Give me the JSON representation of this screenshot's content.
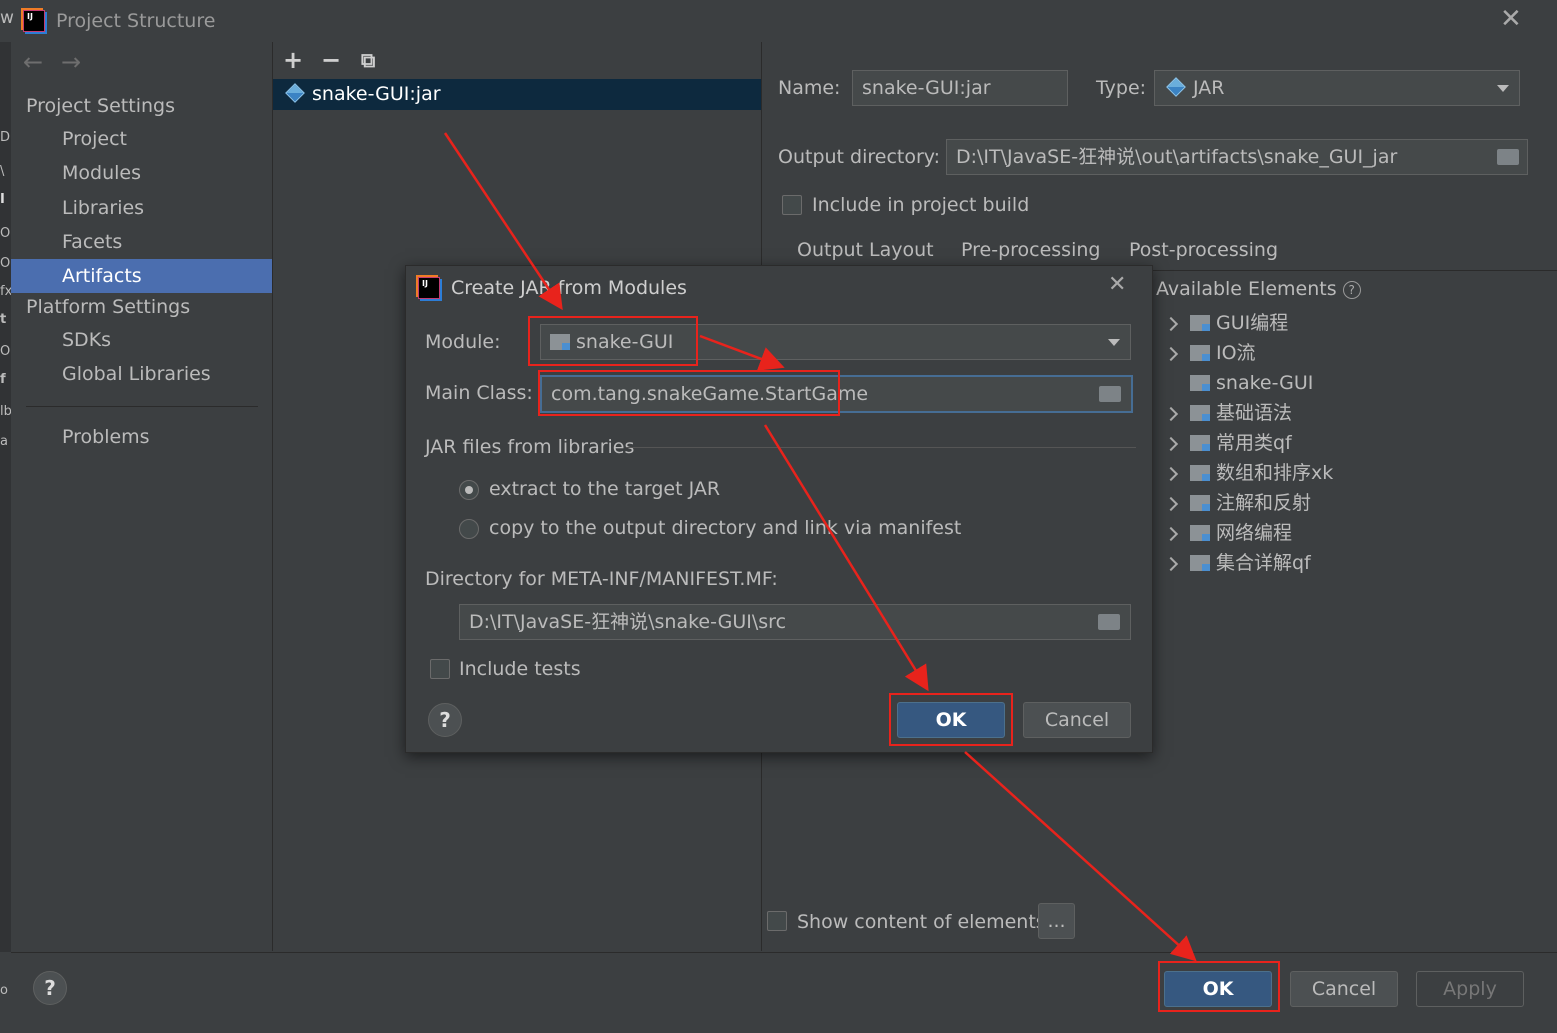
{
  "window": {
    "title": "Project Structure"
  },
  "edge_glyphs": [
    "w",
    "D:",
    "\\",
    "I",
    "O",
    "O",
    "fx",
    "t",
    "O",
    "f",
    "lb",
    "a",
    "o"
  ],
  "nav": {
    "project_settings": "Project Settings",
    "project_items": [
      "Project",
      "Modules",
      "Libraries",
      "Facets",
      "Artifacts"
    ],
    "selected": "Artifacts",
    "platform_settings": "Platform Settings",
    "platform_items": [
      "SDKs",
      "Global Libraries"
    ],
    "problems": "Problems"
  },
  "artifacts": {
    "items": [
      "snake-GUI:jar"
    ]
  },
  "artifact_form": {
    "name_label": "Name:",
    "name_value": "snake-GUI:jar",
    "type_label": "Type:",
    "type_value": "JAR",
    "output_label": "Output directory:",
    "output_value": "D:\\IT\\JavaSE-狂神说\\out\\artifacts\\snake_GUI_jar",
    "include_build": "Include in project build",
    "tabs": [
      "Output Layout",
      "Pre-processing",
      "Post-processing"
    ],
    "available_elements": "Available Elements",
    "elements": [
      {
        "label": "GUI编程",
        "expandable": true
      },
      {
        "label": "IO流",
        "expandable": true
      },
      {
        "label": "snake-GUI",
        "expandable": false
      },
      {
        "label": "基础语法",
        "expandable": true
      },
      {
        "label": "常用类qf",
        "expandable": true
      },
      {
        "label": "数组和排序xk",
        "expandable": true
      },
      {
        "label": "注解和反射",
        "expandable": true
      },
      {
        "label": "网络编程",
        "expandable": true
      },
      {
        "label": "集合详解qf",
        "expandable": true
      }
    ],
    "show_content": "Show content of elements",
    "more_button": "..."
  },
  "dialog": {
    "title": "Create JAR from Modules",
    "module_label": "Module:",
    "module_value": "snake-GUI",
    "main_class_label": "Main Class:",
    "main_class_value": "com.tang.snakeGame.StartGame",
    "jar_section": "JAR files from libraries",
    "radio_extract": "extract to the target JAR",
    "radio_copy": "copy to the output directory and link via manifest",
    "manifest_label": "Directory for META-INF/MANIFEST.MF:",
    "manifest_value": "D:\\IT\\JavaSE-狂神说\\snake-GUI\\src",
    "include_tests": "Include tests",
    "ok": "OK",
    "cancel": "Cancel",
    "help": "?"
  },
  "footer": {
    "ok": "OK",
    "cancel": "Cancel",
    "apply": "Apply",
    "help": "?"
  },
  "colors": {
    "selection": "#4b6eaf",
    "primary_button": "#365880",
    "annotation": "#e8231c",
    "background": "#3c3f41"
  }
}
